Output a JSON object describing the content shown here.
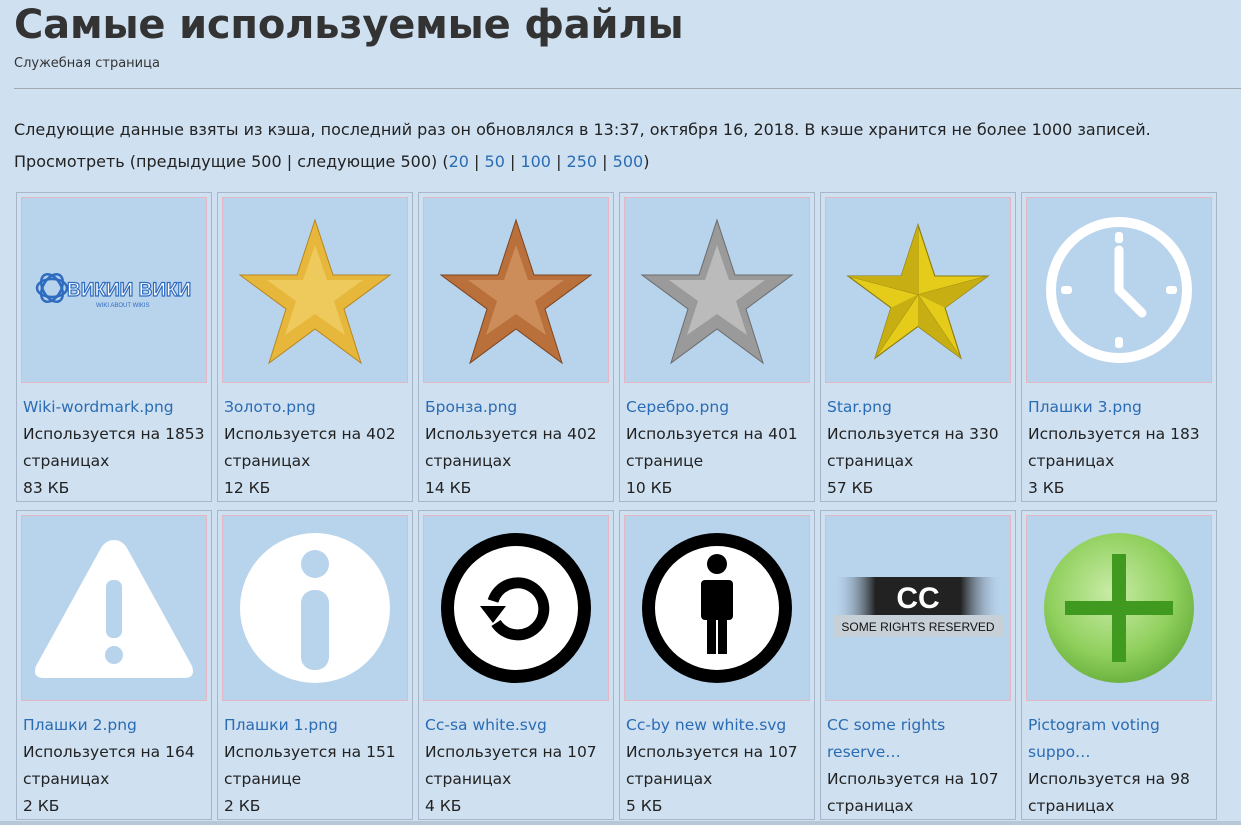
{
  "header": {
    "title": "Самые используемые файлы",
    "subtitle": "Служебная страница"
  },
  "info_text": "Следующие данные взяты из кэша, последний раз он обновлялся в 13:37, октября 16, 2018. В кэше хранится не более 1000 записей.",
  "nav": {
    "prefix": "Просмотреть (предыдущие 500 | следующие 500) (",
    "links": [
      "20",
      "50",
      "100",
      "250",
      "500"
    ],
    "suffix": ")"
  },
  "files": [
    {
      "name": "Wiki-wordmark.png",
      "usage": "Используется на 1853",
      "usage2": "страницах",
      "size": "83 КБ",
      "icon": "wiki-wordmark-logo"
    },
    {
      "name": "Золото.png",
      "usage": "Используется на 402",
      "usage2": "страницах",
      "size": "12 КБ",
      "icon": "gold-star-icon",
      "color": "#e7b73c"
    },
    {
      "name": "Бронза.png",
      "usage": "Используется на 402",
      "usage2": "страницах",
      "size": "14 КБ",
      "icon": "bronze-star-icon",
      "color": "#b9703a"
    },
    {
      "name": "Серебро.png",
      "usage": "Используется на 401",
      "usage2": "странице",
      "size": "10 КБ",
      "icon": "silver-star-icon",
      "color": "#9a9a9a"
    },
    {
      "name": "Star.png",
      "usage": "Используется на 330",
      "usage2": "страницах",
      "size": "57 КБ",
      "icon": "yellow-star-icon",
      "color": "#e6cc1a"
    },
    {
      "name": "Плашки 3.png",
      "usage": "Используется на 183",
      "usage2": "страницах",
      "size": "3 КБ",
      "icon": "clock-icon"
    },
    {
      "name": "Плашки 2.png",
      "usage": "Используется на 164",
      "usage2": "страницах",
      "size": "2 КБ",
      "icon": "warning-icon"
    },
    {
      "name": "Плашки 1.png",
      "usage": "Используется на 151",
      "usage2": "странице",
      "size": "2 КБ",
      "icon": "info-icon"
    },
    {
      "name": "Cc-sa white.svg",
      "usage": "Используется на 107",
      "usage2": "страницах",
      "size": "4 КБ",
      "icon": "cc-sa-icon"
    },
    {
      "name": "Cc-by new white.svg",
      "usage": "Используется на 107",
      "usage2": "страницах",
      "size": "5 КБ",
      "icon": "cc-by-icon"
    },
    {
      "name": "CC some rights",
      "name2": "reserve…",
      "usage": "Используется на 107",
      "usage2": "страницах",
      "icon": "cc-some-rights-icon"
    },
    {
      "name": "Pictogram voting",
      "name2": "suppo…",
      "usage": "Используется на 98",
      "usage2": "страницах",
      "icon": "voting-support-icon"
    }
  ],
  "wordmark": {
    "main": "ВИКИИ ВИКИ",
    "sub": "WIKI ABOUT WIKIS"
  },
  "cc_logo": {
    "main": "CC",
    "sub": "SOME RIGHTS RESERVED"
  }
}
